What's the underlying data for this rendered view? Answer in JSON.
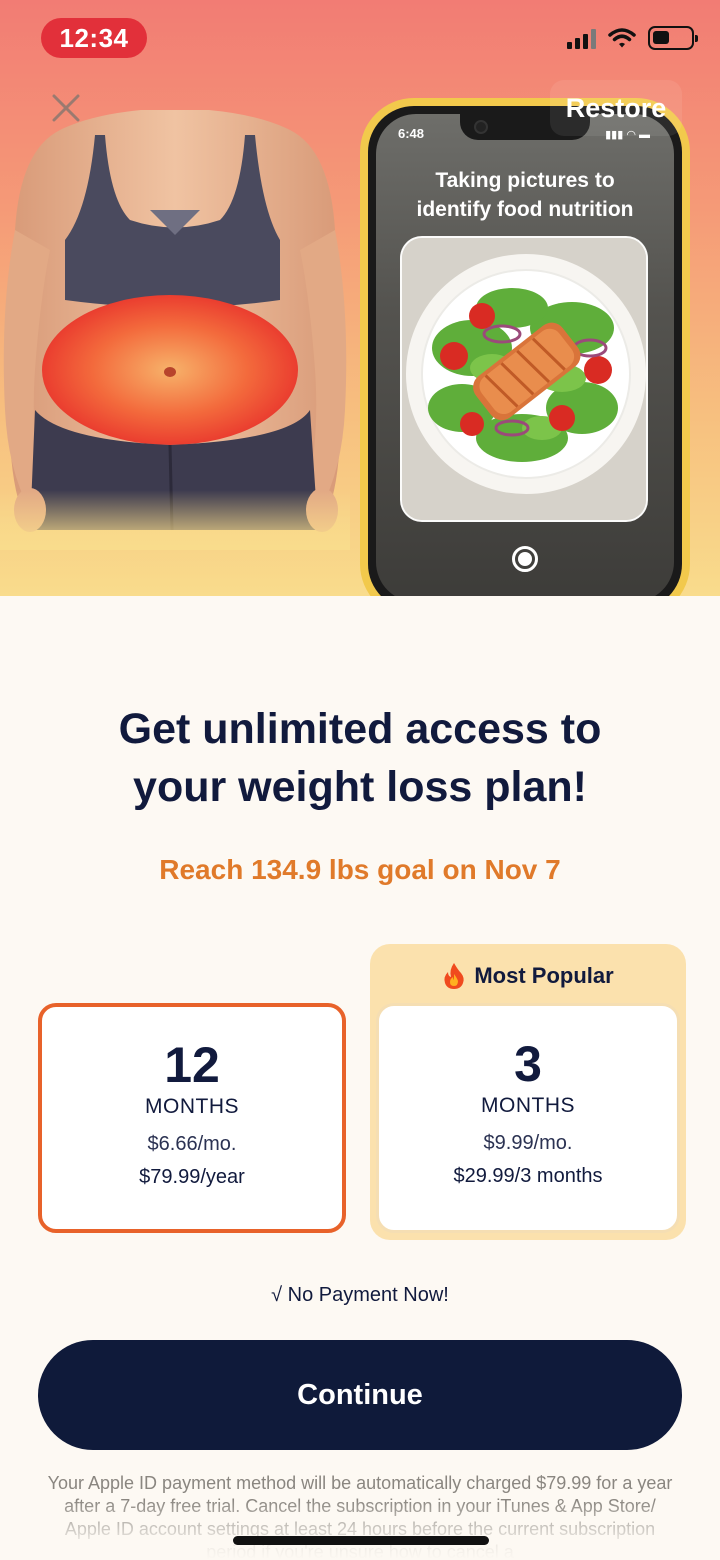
{
  "status_bar": {
    "time": "12:34"
  },
  "header": {
    "restore_label": "Restore"
  },
  "phone_preview": {
    "time": "6:48",
    "caption_line1": "Taking pictures to",
    "caption_line2": "identify food nutrition"
  },
  "main": {
    "headline_line1": "Get unlimited access to",
    "headline_line2": "your weight loss plan!",
    "goal_text": "Reach 134.9 lbs goal on Nov 7"
  },
  "plans": [
    {
      "duration": "12",
      "unit": "MONTHS",
      "per_month": "$6.66/mo.",
      "total": "$79.99/year",
      "selected": true
    },
    {
      "duration": "3",
      "unit": "MONTHS",
      "per_month": "$9.99/mo.",
      "total": "$29.99/3 months",
      "badge": "Most Popular",
      "selected": false
    }
  ],
  "no_payment_text": "√ No Payment Now!",
  "continue_label": "Continue",
  "legal_text": "Your Apple ID payment method will be automatically charged $79.99 for a year after a 7-day free trial. Cancel the subscription in your iTunes & App Store/ Apple ID account settings at least 24 hours before the current subscription period if you're unsure how to cancel a",
  "colors": {
    "accent_orange": "#e8622a",
    "goal_orange": "#e07a2a",
    "navy": "#0f1a3a",
    "popular_bg": "#fbe1ad",
    "time_pill": "#e2303a"
  }
}
